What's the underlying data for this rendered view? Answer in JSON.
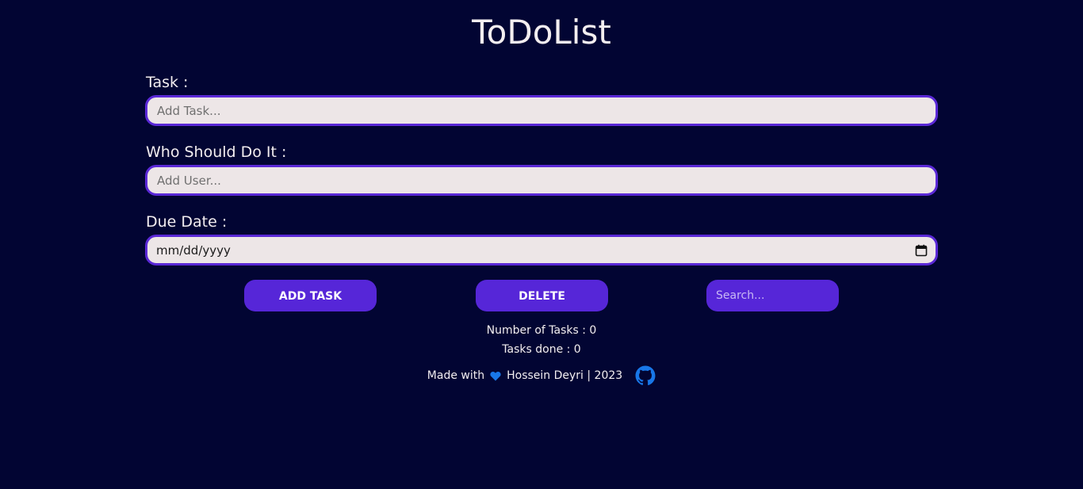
{
  "app": {
    "title": "ToDoList"
  },
  "form": {
    "task_label": "Task :",
    "task_placeholder": "Add Task...",
    "user_label": "Who Should Do It :",
    "user_placeholder": "Add User...",
    "date_label": "Due Date :",
    "date_value": "mm/dd/yyyy"
  },
  "actions": {
    "add_label": "ADD TASK",
    "delete_label": "DELETE",
    "search_placeholder": "Search..."
  },
  "stats": {
    "tasks_count": "Number of Tasks : 0",
    "tasks_done": "Tasks done : 0"
  },
  "footer": {
    "made_with": "Made with",
    "author": "Hossein Deyri | 2023",
    "heart_icon": "heart-icon",
    "github_icon": "github-icon"
  },
  "colors": {
    "background": "#020533",
    "accent": "#5626d8",
    "field_border": "#5a28d6",
    "field_bg": "#ede6e7",
    "icon_blue": "#1877e8"
  }
}
